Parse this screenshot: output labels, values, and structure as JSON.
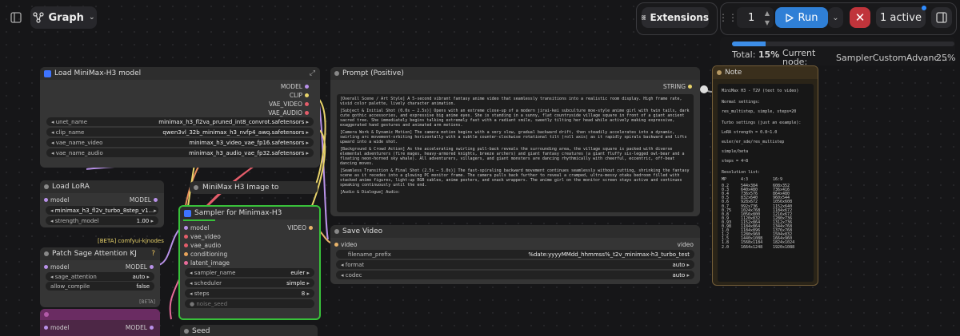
{
  "topbar": {
    "graph_label": "Graph",
    "extensions_label": "Extensions",
    "queue_count": "1",
    "run_label": "Run",
    "active_label": "1 active"
  },
  "progress": {
    "total_label": "Total:",
    "total_value": "15%",
    "total_fraction": 0.15,
    "current_label": "Current node:",
    "current_node": "SamplerCustomAdvanc…",
    "current_value": "25%"
  },
  "nodes": {
    "load_model": {
      "title": "Load MiniMax-H3 model",
      "outputs": [
        "MODEL",
        "CLIP",
        "VAE_VIDEO",
        "VAE_AUDIO"
      ],
      "widgets": [
        {
          "name": "unet_name",
          "value": "minimax_h3_fl2va_pruned_int8_convrot.safetensors"
        },
        {
          "name": "clip_name",
          "value": "qwen3vl_32b_minimax_h3_nvfp4_awq.safetensors"
        },
        {
          "name": "vae_name_video",
          "value": "minimax_h3_video_vae_fp16.safetensors"
        },
        {
          "name": "vae_name_audio",
          "value": "minimax_h3_audio_vae_fp32.safetensors"
        }
      ]
    },
    "prompt": {
      "title": "Prompt (Positive)",
      "output": "STRING",
      "text": [
        "[Overall Scene / Art Style] A 5-second vibrant fantasy anime video that seamlessly transitions into a realistic room display. High frame rate, vivid color palette, lively character animation.",
        "[Subject & Initial Shot (0.0s – 2.5s)] Opens with an extreme close-up of a modern jirai-kei subculture moe-style anime girl with twin tails, dark cute gothic accessories, and expressive big anime eyes. She is standing in a sunny, flat countryside village square in front of a giant ancient sacred tree. She immediately begins talking extremely fast with a radiant smile, sweetly tilting her head while actively making expressive, exaggerated hand gestures and animated arm motions.",
        "[Camera Work & Dynamic Motion] The camera motion begins with a very slow, gradual backward drift, then steadily accelerates into a dynamic, swirling arc movement-orbiting horizontally with a subtle counter-clockwise rotational tilt (roll axis) as it rapidly spirals backward and lifts upward into a wide shot.",
        "[Background & Crowd Action] As the accelerating swirling pull-back reveals the surrounding area, the village square is packed with diverse elemental adventurers (fire mages, heavy-armored knights, breeze archers) and giant fantasy creatures (a giant fluffy six-legged owl-bear and a floating neon-horned sky whale). All adventurers, villagers, and giant monsters are dancing rhythmically with cheerful, eccentric, off-beat dancing moves.",
        "[Seamless Transition & Final Shot (2.5s – 5.0s)] The fast-spiraling backward movement continues seamlessly without cutting, shrinking the fantasy scene as it recedes into a glowing PC monitor frame. The camera pulls back further to reveal a cramped, ultra-messy otaku bedroom filled with stacked anime figures, light-up RGB cables, anime posters, and snack wrappers. The anime girl on the monitor screen stays active and continues speaking continuously until the end.",
        "[Audio & Dialogue] Audio:"
      ]
    },
    "note": {
      "title": "Note",
      "lines": [
        "MiniMax H3 - T2V (text to video)",
        "Normal settings:",
        "res_multistep, simple, steps=20",
        "Turbo settings (just an example):",
        "LoRA strength = 0.8~1.0",
        "euler/er_sde/res_multistep",
        "simple/beta",
        "steps = 4~8",
        "Resolution list:"
      ],
      "res_header": [
        "MP",
        "4:3",
        "16:9"
      ],
      "res_rows": [
        [
          "0.2",
          "544x384",
          "608x352"
        ],
        [
          "0.3",
          "640x480",
          "736x416"
        ],
        [
          "0.4",
          "736x576",
          "864x480"
        ],
        [
          "0.5",
          "832x640",
          "960x544"
        ],
        [
          "0.6",
          "928x672",
          "1056x608"
        ],
        [
          "0.7",
          "992x736",
          "1152x640"
        ],
        [
          "0.75",
          "1024x768",
          "1184x672"
        ],
        [
          "0.8",
          "1056x800",
          "1216x672"
        ],
        [
          "0.9",
          "1120x832",
          "1280x736"
        ],
        [
          "0.93",
          "1152x864",
          "1312x736"
        ],
        [
          "0.98",
          "1184x864",
          "1344x768"
        ],
        [
          "1.0",
          "1184x896",
          "1376x768"
        ],
        [
          "1.2",
          "1280x960",
          "1504x832"
        ],
        [
          "1.5",
          "1440x1088",
          "1664x960"
        ],
        [
          "1.8",
          "1568x1184",
          "1824x1024"
        ],
        [
          "2.0",
          "1664x1248",
          "1920x1088"
        ]
      ]
    },
    "lora": {
      "title": "Load LoRA",
      "input": "model",
      "output": "MODEL",
      "widgets": [
        {
          "name": "",
          "value": "minimax_h3_fl2v_turbo_8step_v1..."
        },
        {
          "name": "strength_model",
          "value": "1.00"
        }
      ]
    },
    "image_to": {
      "title": "MiniMax H3 Image to"
    },
    "beta_label": "[BETA] comfyui-kjnodes",
    "sage": {
      "title": "Patch Sage Attention KJ",
      "input": "model",
      "output": "MODEL",
      "widgets": [
        {
          "name": "sage_attention",
          "value": "auto"
        },
        {
          "name": "allow_compile",
          "value": "false"
        }
      ],
      "beta_tag": "[BETA]"
    },
    "bottom_left": {
      "input": "model",
      "output": "MODEL"
    },
    "sampler": {
      "title": "Sampler for Minimax-H3",
      "inputs": [
        "model",
        "vae_video",
        "vae_audio",
        "conditioning",
        "latent_image"
      ],
      "output": "VIDEO",
      "widgets": [
        {
          "name": "sampler_name",
          "value": "euler"
        },
        {
          "name": "scheduler",
          "value": "simple"
        },
        {
          "name": "steps",
          "value": "8"
        },
        {
          "name": "noise_seed",
          "value": ""
        }
      ]
    },
    "save_video": {
      "title": "Save Video",
      "input": "video",
      "output": "video",
      "widgets": [
        {
          "name": "filename_prefix",
          "value": "%date:yyyyMMdd_hhmmss%_t2v_minimax-h3_turbo_test"
        },
        {
          "name": "format",
          "value": "auto"
        },
        {
          "name": "codec",
          "value": "auto"
        }
      ]
    },
    "seed": {
      "title": "Seed"
    }
  },
  "colors": {
    "accent": "#2f7fd6",
    "stop": "#c0343b",
    "active_node_border": "#38c13a",
    "note_bg": "#2a2418",
    "note_border": "#735d38"
  }
}
